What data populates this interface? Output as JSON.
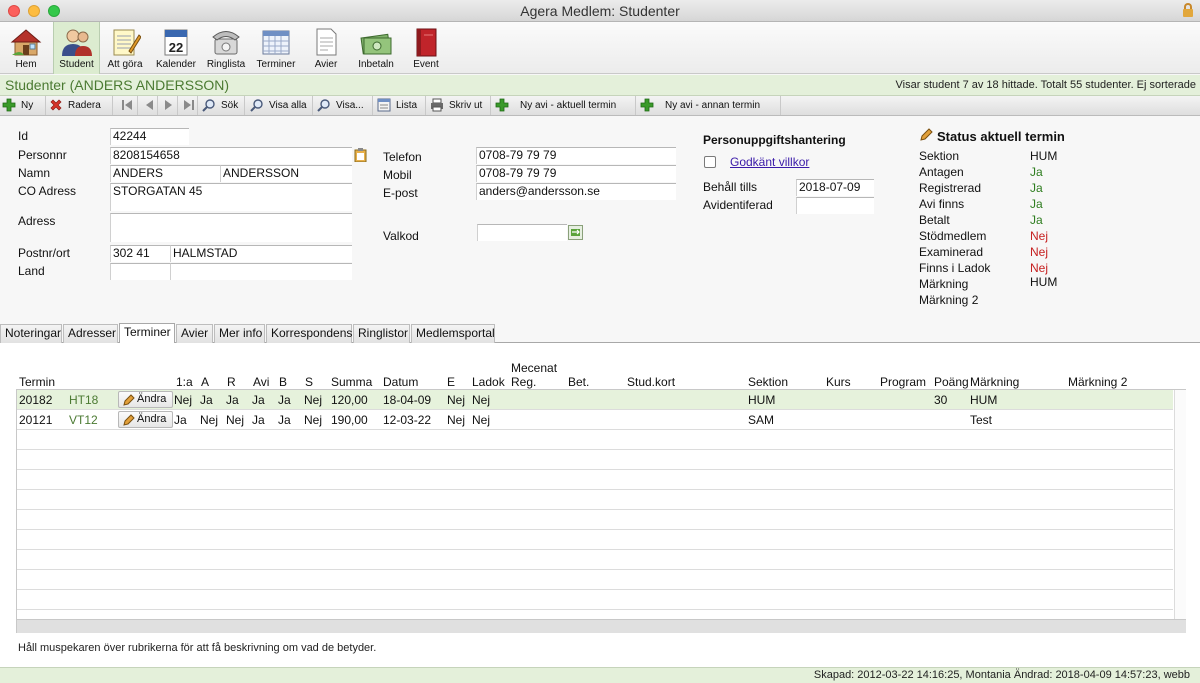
{
  "window": {
    "title": "Agera Medlem: Studenter"
  },
  "toolbar": {
    "items": [
      {
        "label": "Hem",
        "icon": "house-icon"
      },
      {
        "label": "Student",
        "icon": "user-icon"
      },
      {
        "label": "Att göra",
        "icon": "notepad-icon"
      },
      {
        "label": "Kalender",
        "icon": "calendar-icon",
        "day": "22"
      },
      {
        "label": "Ringlista",
        "icon": "telephone-icon"
      },
      {
        "label": "Terminer",
        "icon": "grid-calendar-icon"
      },
      {
        "label": "Avier",
        "icon": "invoice-document-icon"
      },
      {
        "label": "Inbetaln",
        "icon": "money-icon"
      },
      {
        "label": "Event",
        "icon": "red-book-icon"
      }
    ]
  },
  "header": {
    "title": "Studenter (ANDERS ANDERSSON)",
    "status": "Visar student 7 av 18 hittade. Totalt 55 studenter. Ej sorterade"
  },
  "actions": {
    "new": "Ny",
    "delete": "Radera",
    "search": "Sök",
    "show_all": "Visa alla",
    "show": "Visa...",
    "list": "Lista",
    "print": "Skriv ut",
    "new_avi_current": "Ny avi - aktuell termin",
    "new_avi_other": "Ny avi - annan termin"
  },
  "form": {
    "id_label": "Id",
    "id": "42244",
    "personnr_label": "Personnr",
    "personnr": "8208154658",
    "name_label": "Namn",
    "first_name": "ANDERS",
    "last_name": "ANDERSSON",
    "co_label": "CO Adress",
    "co": "STORGATAN 45",
    "address_label": "Adress",
    "address": "",
    "postnr_label": "Postnr/ort",
    "postnr": "302 41",
    "city": "HALMSTAD",
    "country_label": "Land",
    "country_code": "",
    "country": "",
    "phone_label": "Telefon",
    "phone": "0708-79 79 79",
    "mobile_label": "Mobil",
    "mobile": "0708-79 79 79",
    "email_label": "E-post",
    "email": "anders@andersson.se",
    "valkod_label": "Valkod",
    "valkod": ""
  },
  "gdpr": {
    "heading": "Personuppgiftshantering",
    "approved_link": "Godkänt villkor",
    "keep_label": "Behåll tills",
    "keep_until": "2018-07-09",
    "anonymized_label": "Avidentiferad",
    "anonymized": ""
  },
  "status": {
    "heading": "Status aktuell termin",
    "rows": [
      {
        "label": "Sektion",
        "value": "HUM",
        "color": "#111111"
      },
      {
        "label": "Antagen",
        "value": "Ja",
        "color": "#2e7d1f"
      },
      {
        "label": "Registrerad",
        "value": "Ja",
        "color": "#2e7d1f"
      },
      {
        "label": "Avi finns",
        "value": "Ja",
        "color": "#2e7d1f"
      },
      {
        "label": "Betalt",
        "value": "Ja",
        "color": "#2e7d1f"
      },
      {
        "label": "Stödmedlem",
        "value": "Nej",
        "color": "#c62020"
      },
      {
        "label": "Examinerad",
        "value": "Nej",
        "color": "#c62020"
      },
      {
        "label": "Finns i Ladok",
        "value": "Nej",
        "color": "#c62020"
      },
      {
        "label": "Märkning",
        "value": "HUM",
        "color": "#111111"
      },
      {
        "label": "Märkning 2",
        "value": "",
        "color": "#111111"
      }
    ]
  },
  "tabs": [
    "Noteringar",
    "Adresser",
    "Terminer",
    "Avier",
    "Mer info",
    "Korrespondens",
    "Ringlistor",
    "Medlemsportal"
  ],
  "terms_table": {
    "headers": {
      "termin": "Termin",
      "first": "1:a",
      "a": "A",
      "r": "R",
      "avi": "Avi",
      "b": "B",
      "s": "S",
      "summa": "Summa",
      "datum": "Datum",
      "e": "E",
      "ladok": "Ladok",
      "mecenat_top": "Mecenat",
      "mecenat_bottom": "Reg.",
      "bet": "Bet.",
      "studkort": "Stud.kort",
      "sektion": "Sektion",
      "kurs": "Kurs",
      "program": "Program",
      "poang": "Poäng",
      "markning": "Märkning",
      "markning2": "Märkning 2"
    },
    "edit_label": "Ändra",
    "rows": [
      {
        "termin": "20182",
        "code": "HT18",
        "first": "Nej",
        "a": "Ja",
        "r": "Ja",
        "avi": "Ja",
        "b": "Ja",
        "s": "Nej",
        "summa": "120,00",
        "datum": "18-04-09",
        "e": "Nej",
        "ladok": "Nej",
        "sektion": "HUM",
        "poang": "30",
        "markning": "HUM"
      },
      {
        "termin": "20121",
        "code": "VT12",
        "first": "Ja",
        "a": "Nej",
        "r": "Nej",
        "avi": "Ja",
        "b": "Ja",
        "s": "Nej",
        "summa": "190,00",
        "datum": "12-03-22",
        "e": "Nej",
        "ladok": "Nej",
        "sektion": "SAM",
        "poang": "",
        "markning": "Test"
      }
    ]
  },
  "hint": "Håll muspekaren över rubrikerna för att få beskrivning om vad de betyder.",
  "footer": "Skapad: 2012-03-22 14:16:25, Montania Ändrad: 2018-04-09 14:57:23, webb",
  "colors": {
    "accent_green": "#4b7a32",
    "header_bg": "#e4f0da",
    "selected_row": "#e6f2dc",
    "yes": "#2e7d1f",
    "no": "#c62020"
  }
}
